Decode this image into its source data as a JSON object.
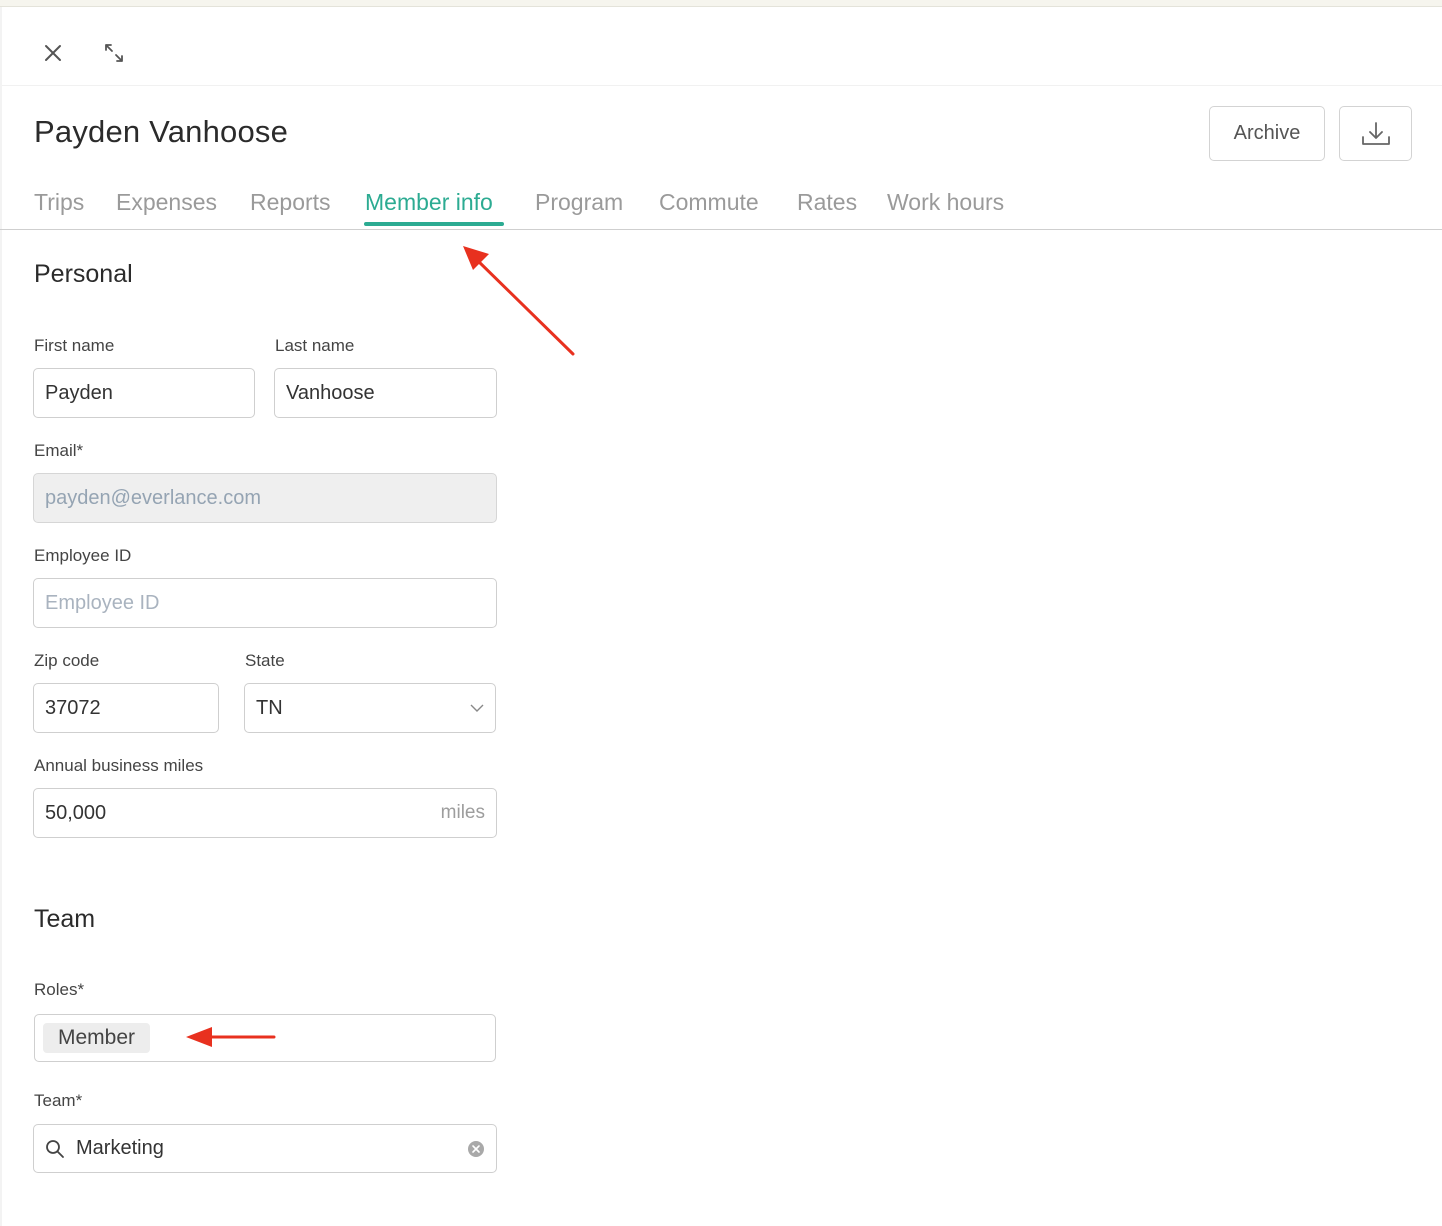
{
  "header": {
    "title": "Payden Vanhoose",
    "archive_label": "Archive"
  },
  "icons": {
    "close": "close-icon",
    "expand": "expand-icon",
    "download": "download-icon",
    "chevron": "chevron-down-icon",
    "search": "search-icon",
    "clear": "clear-icon"
  },
  "tabs": [
    {
      "label": "Trips"
    },
    {
      "label": "Expenses"
    },
    {
      "label": "Reports"
    },
    {
      "label": "Member info",
      "active": true
    },
    {
      "label": "Program"
    },
    {
      "label": "Commute"
    },
    {
      "label": "Rates"
    },
    {
      "label": "Work hours"
    }
  ],
  "personal": {
    "section_title": "Personal",
    "first_name": {
      "label": "First name",
      "value": "Payden"
    },
    "last_name": {
      "label": "Last name",
      "value": "Vanhoose"
    },
    "email": {
      "label": "Email*",
      "value": "payden@everlance.com"
    },
    "employee_id": {
      "label": "Employee ID",
      "placeholder": "Employee ID"
    },
    "zip": {
      "label": "Zip code",
      "value": "37072"
    },
    "state": {
      "label": "State",
      "value": "TN"
    },
    "miles": {
      "label": "Annual business miles",
      "value": "50,000",
      "suffix": "miles"
    }
  },
  "team": {
    "section_title": "Team",
    "roles": {
      "label": "Roles*",
      "chip": "Member"
    },
    "team": {
      "label": "Team*",
      "value": "Marketing"
    }
  },
  "colors": {
    "accent": "#2cab92",
    "annotation_arrow": "#e8311f"
  }
}
